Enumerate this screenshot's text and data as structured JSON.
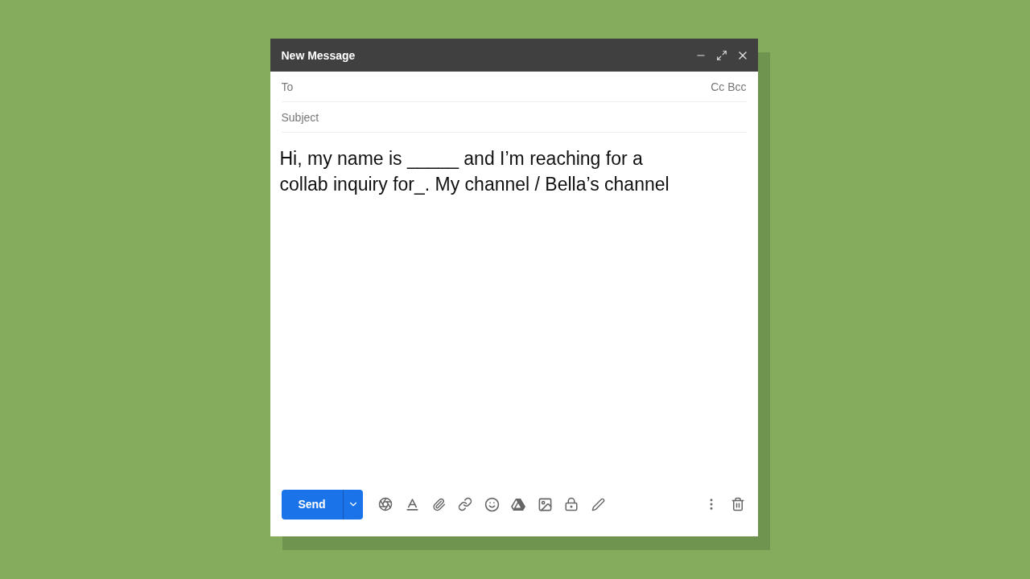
{
  "window": {
    "title": "New Message"
  },
  "to": {
    "placeholder": "To"
  },
  "cc_bcc": "Cc Bcc",
  "subject": {
    "placeholder": "Subject"
  },
  "body_lines": [
    "Hi, my name is _____ and I’m reaching for a",
    "collab inquiry for_. My channel / Bella’s channel"
  ],
  "send_button": "Send"
}
